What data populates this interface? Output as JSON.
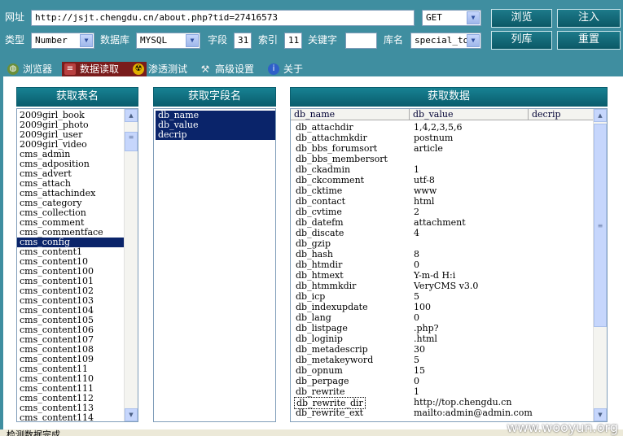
{
  "top": {
    "url_label": "网址",
    "url_value": "http://jsjt.chengdu.cn/about.php?tid=27416573",
    "method": "GET",
    "type_label": "类型",
    "type_value": "Number",
    "db_label": "数据库",
    "db_value": "MYSQL",
    "field_label": "字段",
    "field_value": "31",
    "index_label": "索引",
    "index_value": "11",
    "keyword_label": "关键字",
    "keyword_value": "",
    "dbname_label": "库名",
    "dbname_value": "special_top",
    "browse_btn": "浏览",
    "inject_btn": "注入",
    "listdb_btn": "列库",
    "reset_btn": "重置"
  },
  "tabs": [
    {
      "label": "浏览器",
      "icon": "globe-icon"
    },
    {
      "label": "数据读取",
      "icon": "database-icon"
    },
    {
      "label": "渗透测试",
      "icon": "radiation-icon"
    },
    {
      "label": "高级设置",
      "icon": "tools-icon"
    },
    {
      "label": "关于",
      "icon": "info-icon"
    }
  ],
  "panels": {
    "tables_title": "获取表名",
    "fields_title": "获取字段名",
    "data_title": "获取数据"
  },
  "tables": [
    "2009girl_book",
    "2009girl_photo",
    "2009girl_user",
    "2009girl_video",
    "cms_admin",
    "cms_adposition",
    "cms_advert",
    "cms_attach",
    "cms_attachindex",
    "cms_category",
    "cms_collection",
    "cms_comment",
    "cms_commentface",
    "cms_config",
    "cms_content1",
    "cms_content10",
    "cms_content100",
    "cms_content101",
    "cms_content102",
    "cms_content103",
    "cms_content104",
    "cms_content105",
    "cms_content106",
    "cms_content107",
    "cms_content108",
    "cms_content109",
    "cms_content11",
    "cms_content110",
    "cms_content111",
    "cms_content112",
    "cms_content113",
    "cms_content114"
  ],
  "selected_table": "cms_config",
  "fields": [
    "db_name",
    "db_value",
    "decrip"
  ],
  "grid_headers": [
    "db_name",
    "db_value",
    "decrip"
  ],
  "grid_rows": [
    [
      "db_attachdir",
      "1,4,2,3,5,6"
    ],
    [
      "db_attachmkdir",
      "postnum"
    ],
    [
      "db_bbs_forumsort",
      "article"
    ],
    [
      "db_bbs_membersort",
      ""
    ],
    [
      "db_ckadmin",
      "1"
    ],
    [
      "db_ckcomment",
      "utf-8"
    ],
    [
      "db_cktime",
      "www"
    ],
    [
      "db_contact",
      "html"
    ],
    [
      "db_cvtime",
      "2"
    ],
    [
      "db_datefm",
      "attachment"
    ],
    [
      "db_discate",
      "4"
    ],
    [
      "db_gzip",
      ""
    ],
    [
      "db_hash",
      "8"
    ],
    [
      "db_htmdir",
      "0"
    ],
    [
      "db_htmext",
      "Y-m-d H:i"
    ],
    [
      "db_htmmkdir",
      "VeryCMS v3.0"
    ],
    [
      "db_icp",
      "5"
    ],
    [
      "db_indexupdate",
      "100"
    ],
    [
      "db_lang",
      "0"
    ],
    [
      "db_listpage",
      ".php?"
    ],
    [
      "db_loginip",
      ".html"
    ],
    [
      "db_metadescrip",
      "30"
    ],
    [
      "db_metakeyword",
      "5"
    ],
    [
      "db_opnum",
      "15"
    ],
    [
      "db_perpage",
      "0"
    ],
    [
      "db_rewrite",
      "1"
    ],
    [
      "db_rewrite_dir",
      "http://top.chengdu.cn"
    ],
    [
      "db_rewrite_ext",
      "mailto:admin@admin.com"
    ]
  ],
  "focused_row": "db_rewrite_dir",
  "status_text": "检测数据完成",
  "watermark": "www.wooyun.org"
}
